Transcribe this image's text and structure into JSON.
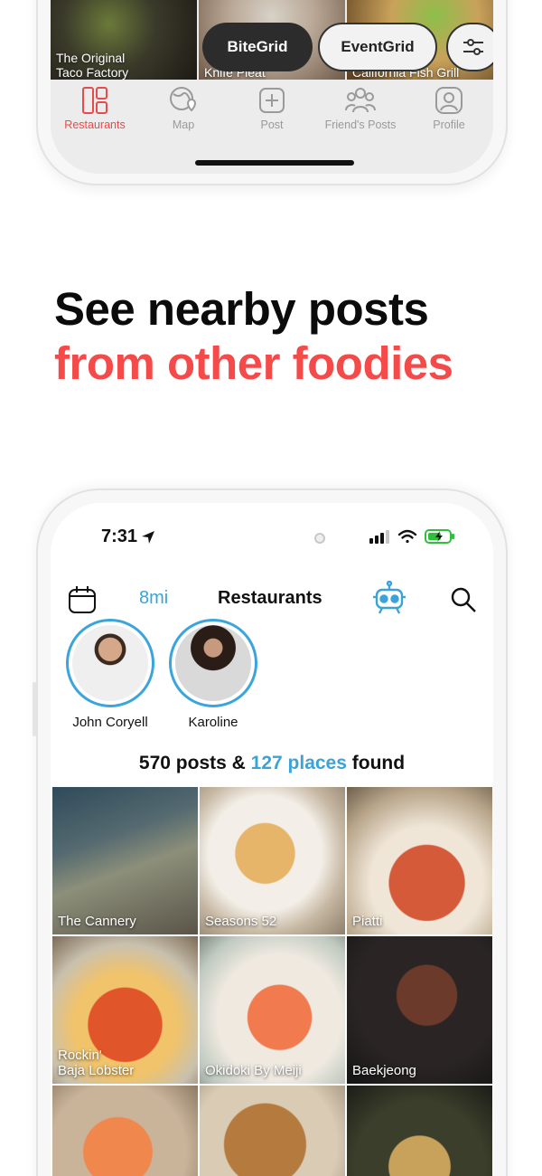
{
  "top_phone": {
    "tiles": [
      {
        "label": "The Original\nTaco Factory"
      },
      {
        "label": "Knife Pleat"
      },
      {
        "label": "California Fish Grill"
      }
    ],
    "pills": {
      "bitegrid": "BiteGrid",
      "eventgrid": "EventGrid"
    },
    "tabs": [
      {
        "label": "Restaurants",
        "icon": "restaurants-grid-icon",
        "active": true
      },
      {
        "label": "Map",
        "icon": "map-globe-icon",
        "active": false
      },
      {
        "label": "Post",
        "icon": "post-plus-icon",
        "active": false
      },
      {
        "label": "Friend's Posts",
        "icon": "friends-icon",
        "active": false
      },
      {
        "label": "Profile",
        "icon": "profile-icon",
        "active": false
      }
    ]
  },
  "headline": {
    "line1": "See nearby posts",
    "line2": "from other foodies"
  },
  "phone": {
    "status": {
      "time": "7:31"
    },
    "nav": {
      "distance": "8mi",
      "title": "Restaurants"
    },
    "stories": [
      {
        "name": "John Coryell"
      },
      {
        "name": "Karoline"
      }
    ],
    "summary": {
      "posts": "570 posts &",
      "places": "127 places",
      "suffix": "found"
    },
    "grid": [
      {
        "label": "The Cannery"
      },
      {
        "label": "Seasons 52"
      },
      {
        "label": "Piatti"
      },
      {
        "label": "Rockin'\nBaja Lobster"
      },
      {
        "label": "Okidoki By Meiji"
      },
      {
        "label": "Baekjeong"
      },
      {
        "label": ""
      },
      {
        "label": ""
      },
      {
        "label": ""
      }
    ]
  },
  "colors": {
    "accent_red": "#f44a4a",
    "accent_blue": "#3ba3d8",
    "tab_active": "#e84b4b",
    "tab_inactive": "#9a9a9a"
  }
}
